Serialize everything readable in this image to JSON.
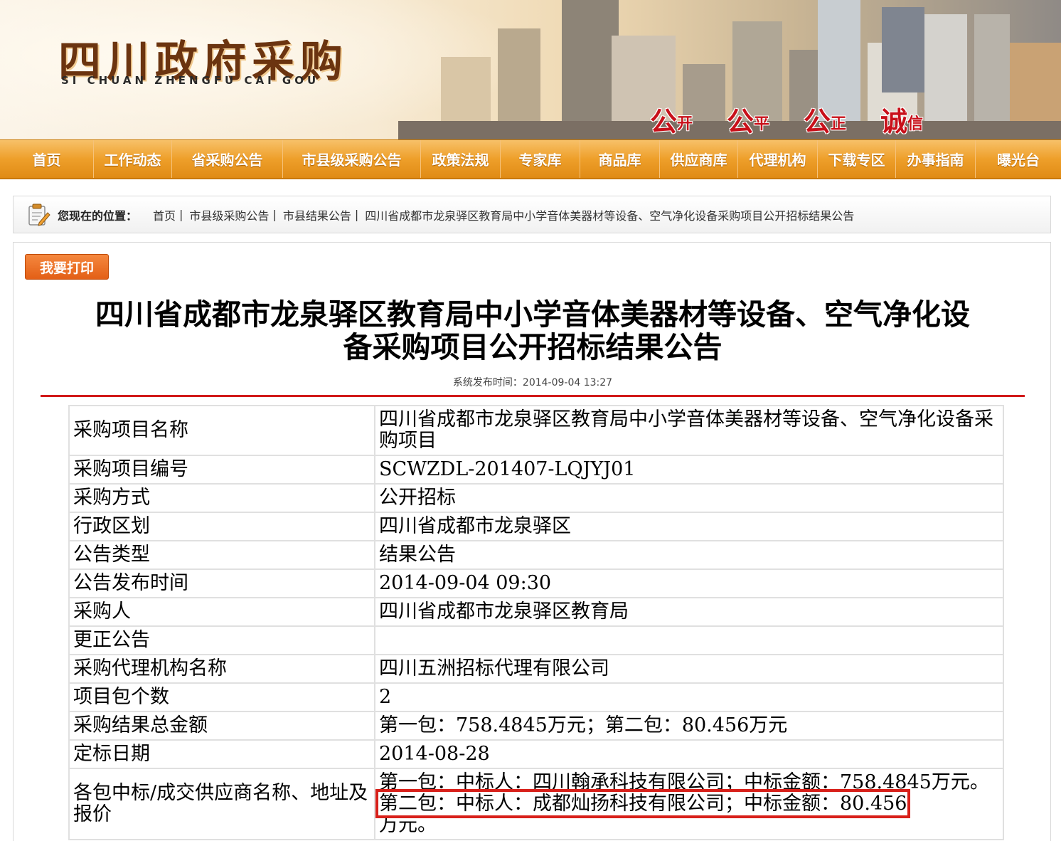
{
  "banner": {
    "logo_cn": "四川政府采购",
    "logo_en": "SI CHUAN ZHENGFU CAI GOU",
    "slogan": [
      {
        "big": "公",
        "small": "开"
      },
      {
        "big": "公",
        "small": "平"
      },
      {
        "big": "公",
        "small": "正"
      },
      {
        "big": "诚",
        "small": "信"
      }
    ]
  },
  "nav": [
    "首页",
    "工作动态",
    "省采购公告",
    "市县级采购公告",
    "政策法规",
    "专家库",
    "商品库",
    "供应商库",
    "代理机构",
    "下载专区",
    "办事指南",
    "曝光台"
  ],
  "breadcrumb": {
    "label": "您现在的位置：",
    "items": [
      "首页",
      "市县级采购公告",
      "市县结果公告",
      "四川省成都市龙泉驿区教育局中小学音体美器材等设备、空气净化设备采购项目公开招标结果公告"
    ],
    "separator": "|"
  },
  "print_button": "我要打印",
  "title_line1": "四川省成都市龙泉驿区教育局中小学音体美器材等设备、空气净化设",
  "title_line2": "备采购项目公开招标结果公告",
  "publish_time": "系统发布时间：2014-09-04 13:27",
  "colors": {
    "accent_orange": "#ee9f2a",
    "red_rule": "#d11a1a",
    "highlight_box": "#d8201a"
  },
  "rows": [
    {
      "key": "采购项目名称",
      "value": "四川省成都市龙泉驿区教育局中小学音体美器材等设备、空气净化设备采购项目"
    },
    {
      "key": "采购项目编号",
      "value": "SCWZDL-201407-LQJYJ01"
    },
    {
      "key": "采购方式",
      "value": "公开招标"
    },
    {
      "key": "行政区划",
      "value": "四川省成都市龙泉驿区"
    },
    {
      "key": "公告类型",
      "value": "结果公告"
    },
    {
      "key": "公告发布时间",
      "value": "2014-09-04 09:30"
    },
    {
      "key": "采购人",
      "value": "四川省成都市龙泉驿区教育局"
    },
    {
      "key": "更正公告",
      "value": ""
    },
    {
      "key": "采购代理机构名称",
      "value": "四川五洲招标代理有限公司"
    },
    {
      "key": "项目包个数",
      "value": "2"
    },
    {
      "key": "采购结果总金额",
      "value": "第一包：758.4845万元；第二包：80.456万元"
    },
    {
      "key": "定标日期",
      "value": "2014-08-28"
    }
  ],
  "last_row": {
    "key": "各包中标/成交供应商名称、地址及报价",
    "value_part1": "第一包：中标人：四川翰承科技有限公司；中标金额：758.4845万元。",
    "value_part2": "第二包：中标人：成都灿扬科技有限公司；中标金额：80.456",
    "value_part3": "万元。"
  }
}
